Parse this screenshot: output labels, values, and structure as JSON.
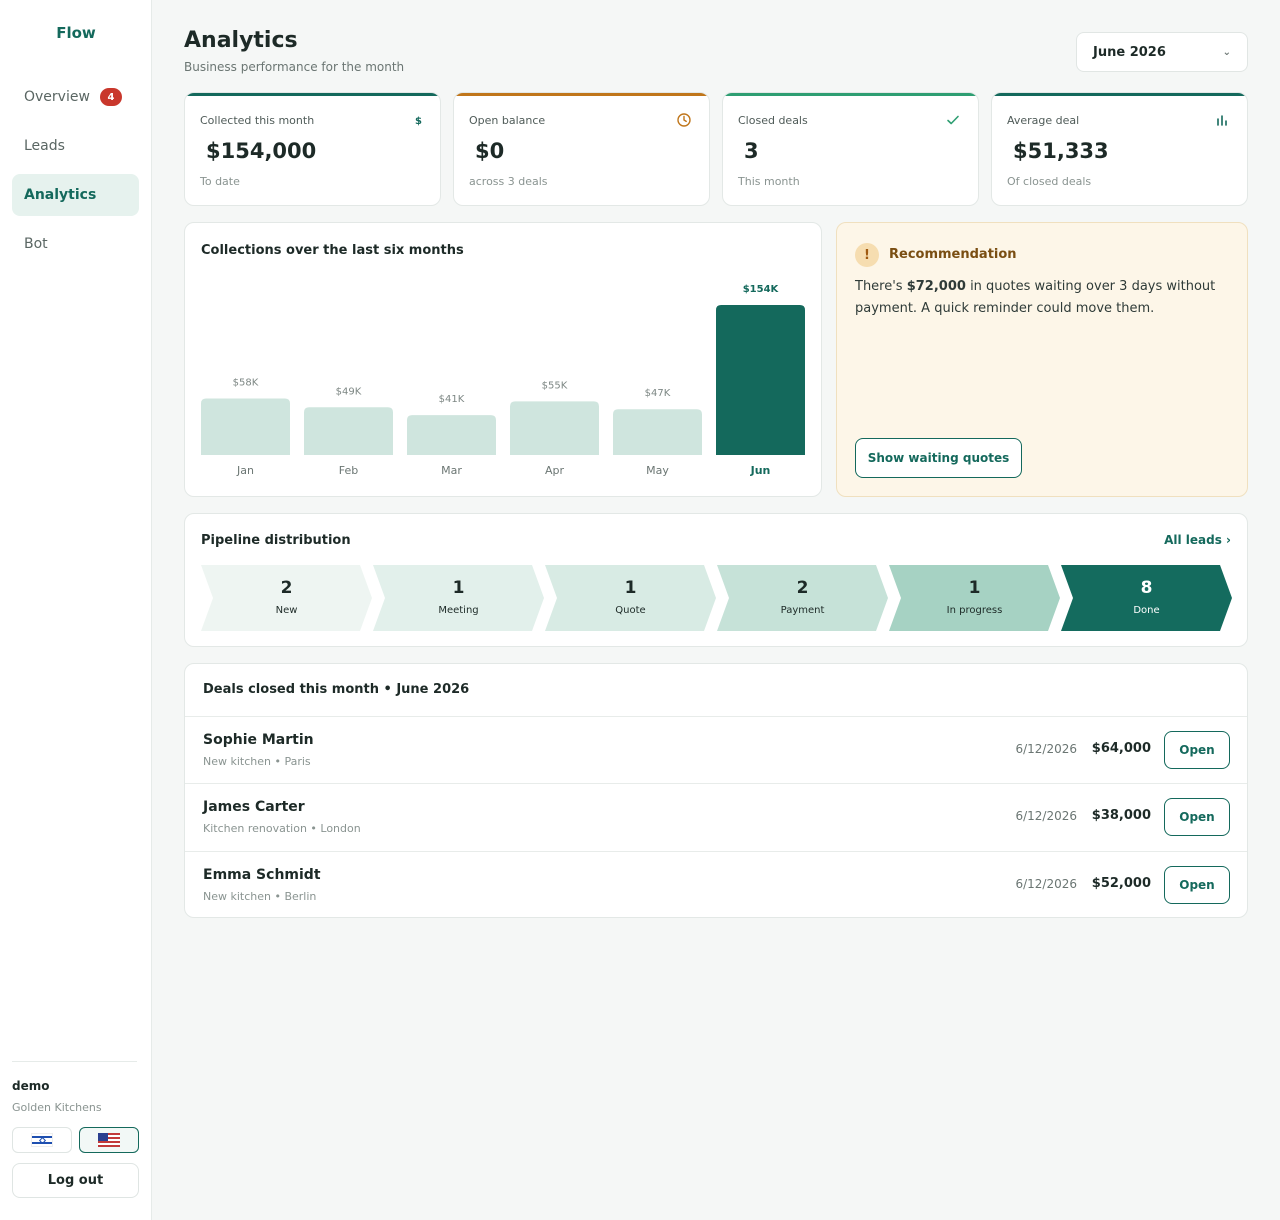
{
  "sidebar": {
    "brand": "Flow",
    "items": [
      {
        "label": "Overview",
        "badge": "4"
      },
      {
        "label": "Leads"
      },
      {
        "label": "Analytics"
      },
      {
        "label": "Bot"
      }
    ],
    "user": {
      "name": "demo",
      "company": "Golden Kitchens"
    },
    "logout_label": "Log out"
  },
  "header": {
    "title": "Analytics",
    "subtitle": "Business performance for the month",
    "month_select": "June 2026"
  },
  "kpis": [
    {
      "label": "Collected this month",
      "value": "$154,000",
      "note": "To date",
      "icon": "dollar-icon",
      "color": "#14695c"
    },
    {
      "label": "Open balance",
      "value": "$0",
      "note": "across 3 deals",
      "icon": "clock-icon",
      "color": "#c0761b"
    },
    {
      "label": "Closed deals",
      "value": "3",
      "note": "This month",
      "icon": "check-icon",
      "color": "#2e9e72"
    },
    {
      "label": "Average deal",
      "value": "$51,333",
      "note": "Of closed deals",
      "icon": "bar-chart-icon",
      "color": "#14695c"
    }
  ],
  "chart_data": {
    "type": "bar",
    "title": "Collections over the last six months",
    "categories": [
      "Jan",
      "Feb",
      "Mar",
      "Apr",
      "May",
      "Jun"
    ],
    "values": [
      58000,
      49000,
      41000,
      55000,
      47000,
      154000
    ],
    "data_labels": [
      "$58K",
      "$49K",
      "$41K",
      "$55K",
      "$47K",
      "$154K"
    ],
    "highlight": "Jun",
    "colors": {
      "bar": "#cfe5de",
      "highlight": "#14695c"
    },
    "grid": false,
    "xlabel": "",
    "ylabel": ""
  },
  "recommendation": {
    "title": "Recommendation",
    "text_before": "There's ",
    "amount": "$72,000",
    "text_after": " in quotes waiting over 3 days without payment. A quick reminder could move them.",
    "button": "Show waiting quotes"
  },
  "pipeline": {
    "title": "Pipeline distribution",
    "link": "All leads ›",
    "stages": [
      {
        "count": "2",
        "name": "New",
        "bg": "#eef5f2",
        "fg": "#1d2a27"
      },
      {
        "count": "1",
        "name": "Meeting",
        "bg": "#e2f0eb",
        "fg": "#1d2a27"
      },
      {
        "count": "1",
        "name": "Quote",
        "bg": "#d8ebe4",
        "fg": "#1d2a27"
      },
      {
        "count": "2",
        "name": "Payment",
        "bg": "#c6e2d8",
        "fg": "#1d2a27"
      },
      {
        "count": "1",
        "name": "In progress",
        "bg": "#a6d2c3",
        "fg": "#1d2a27"
      },
      {
        "count": "8",
        "name": "Done",
        "bg": "#146b5e",
        "fg": "#ffffff"
      }
    ]
  },
  "deals": {
    "title": "Deals closed this month • June 2026",
    "rows": [
      {
        "name": "Sophie Martin",
        "meta": "New kitchen • Paris",
        "date": "6/12/2026",
        "amount": "$64,000",
        "action": "Open"
      },
      {
        "name": "James Carter",
        "meta": "Kitchen renovation • London",
        "date": "6/12/2026",
        "amount": "$38,000",
        "action": "Open"
      },
      {
        "name": "Emma Schmidt",
        "meta": "New kitchen • Berlin",
        "date": "6/12/2026",
        "amount": "$52,000",
        "action": "Open"
      }
    ]
  }
}
